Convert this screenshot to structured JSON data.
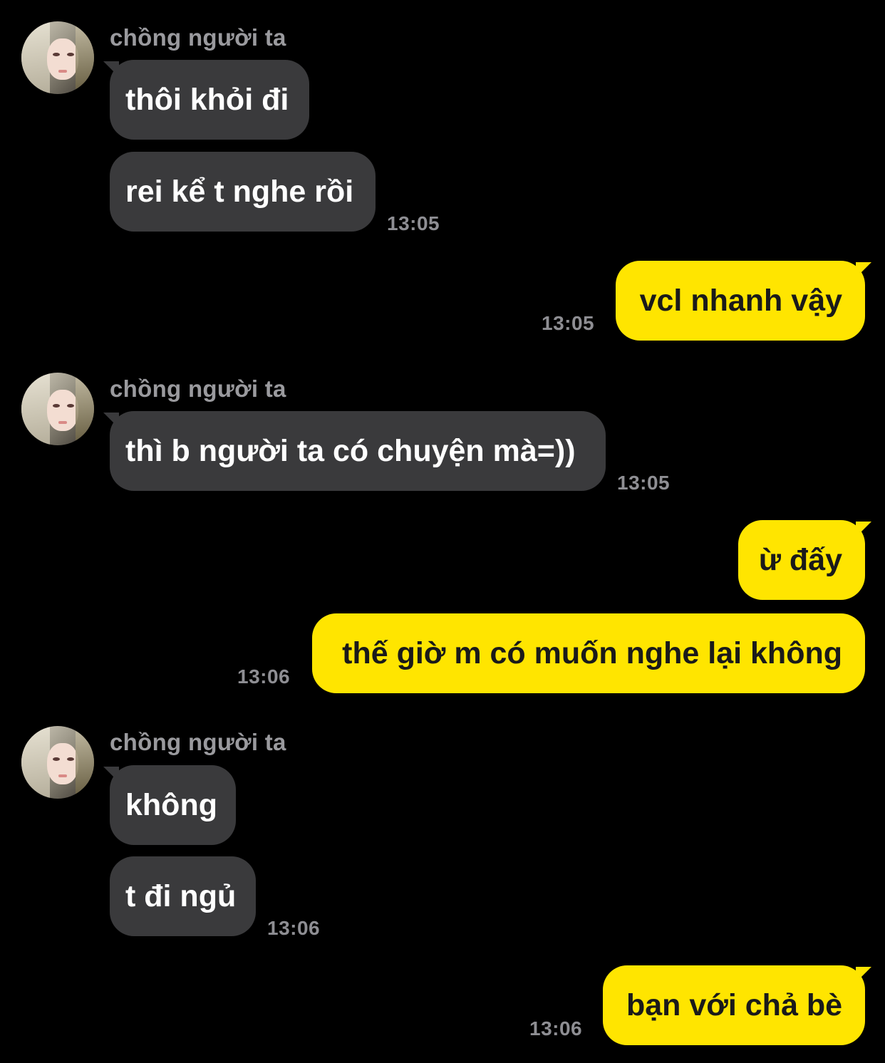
{
  "contact": {
    "name": "chồng người ta"
  },
  "colors": {
    "background": "#000000",
    "incoming_bubble": "#3a3a3c",
    "outgoing_bubble": "#ffe500",
    "timestamp": "#8e8e93"
  },
  "messages": [
    {
      "dir": "in",
      "text": "thôi khỏi đi"
    },
    {
      "dir": "in",
      "text": "rei kể t nghe rồi",
      "time": "13:05"
    },
    {
      "dir": "out",
      "text": "vcl nhanh vậy",
      "time": "13:05"
    },
    {
      "dir": "in",
      "text": "thì b người ta có chuyện mà=))",
      "time": "13:05"
    },
    {
      "dir": "out",
      "text": "ừ đấy"
    },
    {
      "dir": "out",
      "text": "thế giờ m có muốn nghe lại không",
      "time": "13:06"
    },
    {
      "dir": "in",
      "text": "không"
    },
    {
      "dir": "in",
      "text": "t đi ngủ",
      "time": "13:06"
    },
    {
      "dir": "out",
      "text": "bạn với chả bè",
      "time": "13:06"
    }
  ]
}
